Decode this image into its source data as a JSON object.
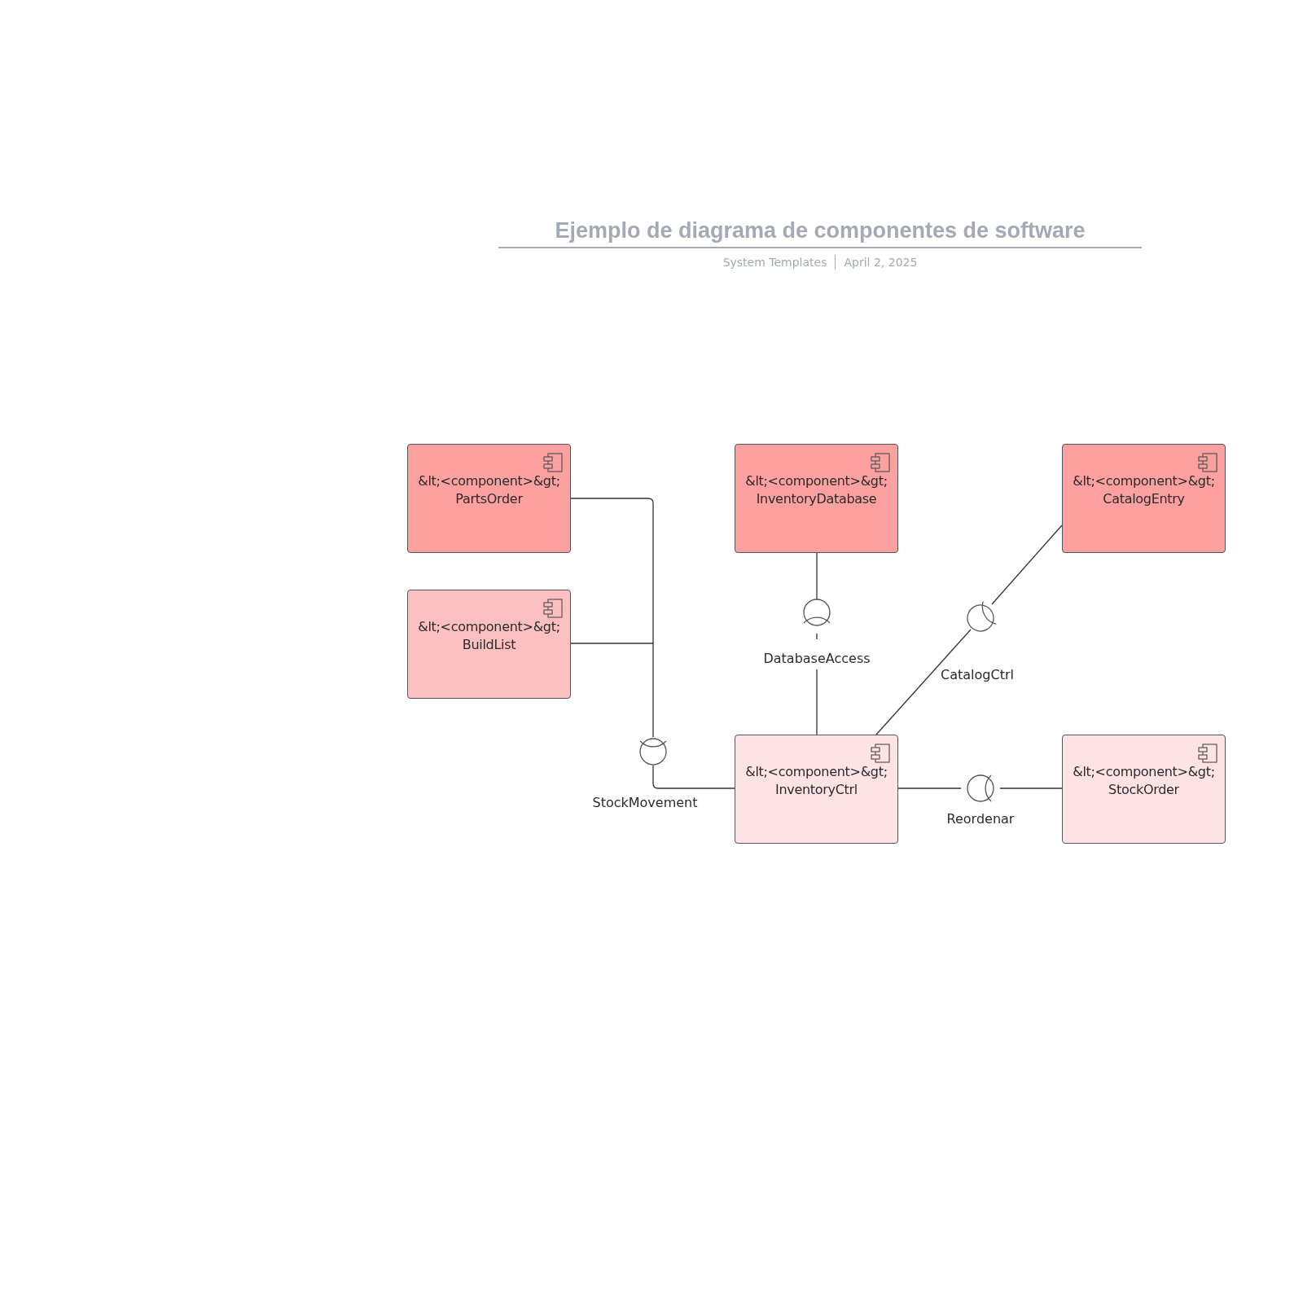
{
  "header": {
    "title": "Ejemplo de diagrama de componentes de software",
    "source": "System Templates",
    "date": "April 2, 2025"
  },
  "components": [
    {
      "stereotype": "&lt;<component>&gt;",
      "name": "PartsOrder",
      "color": "#fca0a0"
    },
    {
      "stereotype": "&lt;<component>&gt;",
      "name": "InventoryDatabase",
      "color": "#fca0a0"
    },
    {
      "stereotype": "&lt;<component>&gt;",
      "name": "CatalogEntry",
      "color": "#fca0a0"
    },
    {
      "stereotype": "&lt;<component>&gt;",
      "name": "BuildList",
      "color": "#fdc0c0"
    },
    {
      "stereotype": "&lt;<component>&gt;",
      "name": "InventoryCtrl",
      "color": "#ffe2e4"
    },
    {
      "stereotype": "&lt;<component>&gt;",
      "name": "StockOrder",
      "color": "#ffe2e4"
    }
  ],
  "interfaces": [
    {
      "label": "DatabaseAccess"
    },
    {
      "label": "CatalogCtrl"
    },
    {
      "label": "StockMovement"
    },
    {
      "label": "Reordenar"
    }
  ]
}
